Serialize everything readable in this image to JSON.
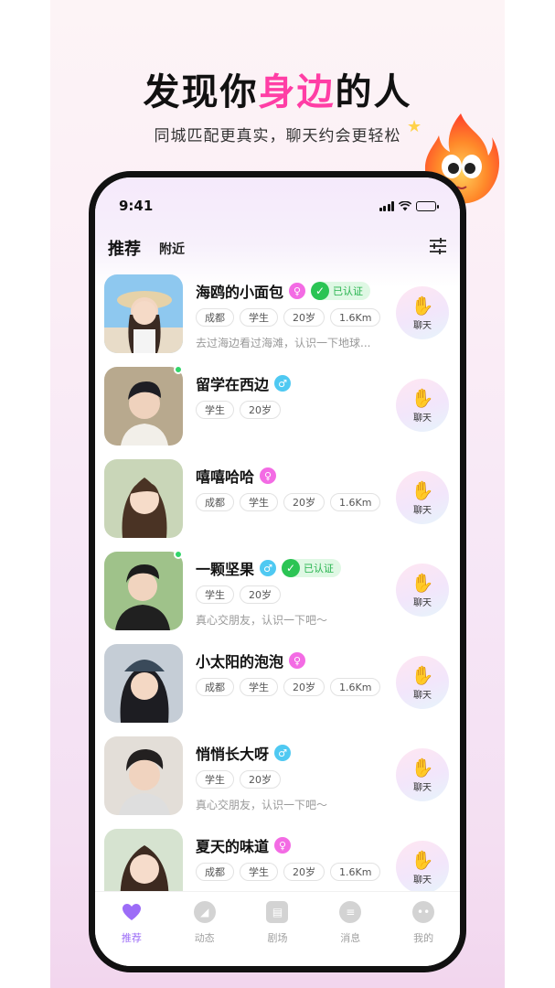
{
  "poster": {
    "headline_pre": "发现你",
    "headline_accent": "身边",
    "headline_post": "的人",
    "subline": "同城匹配更真实，聊天约会更轻松"
  },
  "status": {
    "time": "9:41"
  },
  "tabs": {
    "active": "推荐",
    "other": "附近"
  },
  "colors": {
    "accent": "#ff3ea5",
    "female": "#f36be4",
    "male": "#4fc9f2",
    "verified": "#2bc454",
    "tab_active": "#9c6cf7"
  },
  "users": [
    {
      "name": "海鸥的小面包",
      "gender": "♀",
      "verified": "已认证",
      "tags": [
        "成都",
        "学生",
        "20岁",
        "1.6Km"
      ],
      "bio": "去过海边看过海滩，认识一下地球...",
      "chat": "聊天"
    },
    {
      "name": "留学在西边",
      "gender": "♂",
      "tags": [
        "学生",
        "20岁"
      ],
      "bio": "",
      "chat": "聊天"
    },
    {
      "name": "嘻嘻哈哈",
      "gender": "♀",
      "tags": [
        "成都",
        "学生",
        "20岁",
        "1.6Km"
      ],
      "bio": "",
      "chat": "聊天"
    },
    {
      "name": "一颗坚果",
      "gender": "♂",
      "verified": "已认证",
      "tags": [
        "学生",
        "20岁"
      ],
      "bio": "真心交朋友，认识一下吧～",
      "chat": "聊天"
    },
    {
      "name": "小太阳的泡泡",
      "gender": "♀",
      "tags": [
        "成都",
        "学生",
        "20岁",
        "1.6Km"
      ],
      "bio": "",
      "chat": "聊天"
    },
    {
      "name": "悄悄长大呀",
      "gender": "♂",
      "tags": [
        "学生",
        "20岁"
      ],
      "bio": "真心交朋友，认识一下吧～",
      "chat": "聊天"
    },
    {
      "name": "夏天的味道",
      "gender": "♀",
      "tags": [
        "成都",
        "学生",
        "20岁",
        "1.6Km"
      ],
      "bio": "",
      "chat": "聊天"
    }
  ],
  "tabbar": [
    {
      "label": "推荐",
      "icon": "heart-icon"
    },
    {
      "label": "动态",
      "icon": "compass-icon"
    },
    {
      "label": "剧场",
      "icon": "map-icon"
    },
    {
      "label": "消息",
      "icon": "message-icon"
    },
    {
      "label": "我的",
      "icon": "profile-icon"
    }
  ]
}
